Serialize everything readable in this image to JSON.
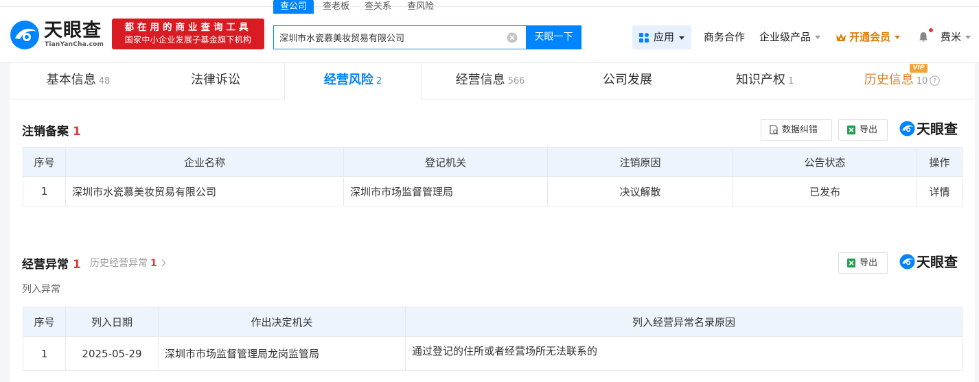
{
  "header": {
    "logo": {
      "name_cn": "天眼查",
      "name_en": "TianYanCha.com"
    },
    "slogan": {
      "line1": "都在用的商业查询工具",
      "line2": "国家中小企业发展子基金旗下机构"
    },
    "search_tabs": [
      "查公司",
      "查老板",
      "查关系",
      "查风险"
    ],
    "search_value": "深圳市水瓷慕美妆贸易有限公司",
    "search_button": "天眼一下",
    "nav": {
      "apps": "应用",
      "business": "商务合作",
      "enterprise": "企业级产品",
      "vip": "开通会员",
      "user": "费米"
    }
  },
  "tabs": [
    {
      "label": "基本信息",
      "count": "48"
    },
    {
      "label": "法律诉讼",
      "count": ""
    },
    {
      "label": "经营风险",
      "count": "2"
    },
    {
      "label": "经营信息",
      "count": "566"
    },
    {
      "label": "公司发展",
      "count": ""
    },
    {
      "label": "知识产权",
      "count": "1"
    },
    {
      "label": "历史信息",
      "count": "10"
    }
  ],
  "vip_badge": "VIP",
  "brand_label": "天眼查",
  "toolbar": {
    "correct": "数据纠错",
    "export": "导出"
  },
  "cancel_section": {
    "title": "注销备案",
    "count": "1",
    "headers": [
      "序号",
      "企业名称",
      "登记机关",
      "注销原因",
      "公告状态",
      "操作"
    ],
    "rows": [
      {
        "index": "1",
        "company": "深圳市水瓷慕美妆贸易有限公司",
        "authority": "深圳市市场监督管理局",
        "reason": "决议解散",
        "status": "已发布",
        "action": "详情"
      }
    ]
  },
  "abnormal_section": {
    "title": "经营异常",
    "count": "1",
    "history_label": "历史经营异常",
    "history_count": "1",
    "sub_label": "列入异常",
    "headers": [
      "序号",
      "列入日期",
      "作出决定机关",
      "列入经营异常名录原因"
    ],
    "rows": [
      {
        "index": "1",
        "date": "2025-05-29",
        "authority": "深圳市市场监督管理局龙岗监管局",
        "reason": "通过登记的住所或者经营场所无法联系的"
      }
    ]
  },
  "colors": {
    "primary": "#0084ff",
    "danger": "#e03b3b",
    "slogan_bg": "#d91c24",
    "vip": "#e07a00",
    "history": "#d9822b"
  }
}
